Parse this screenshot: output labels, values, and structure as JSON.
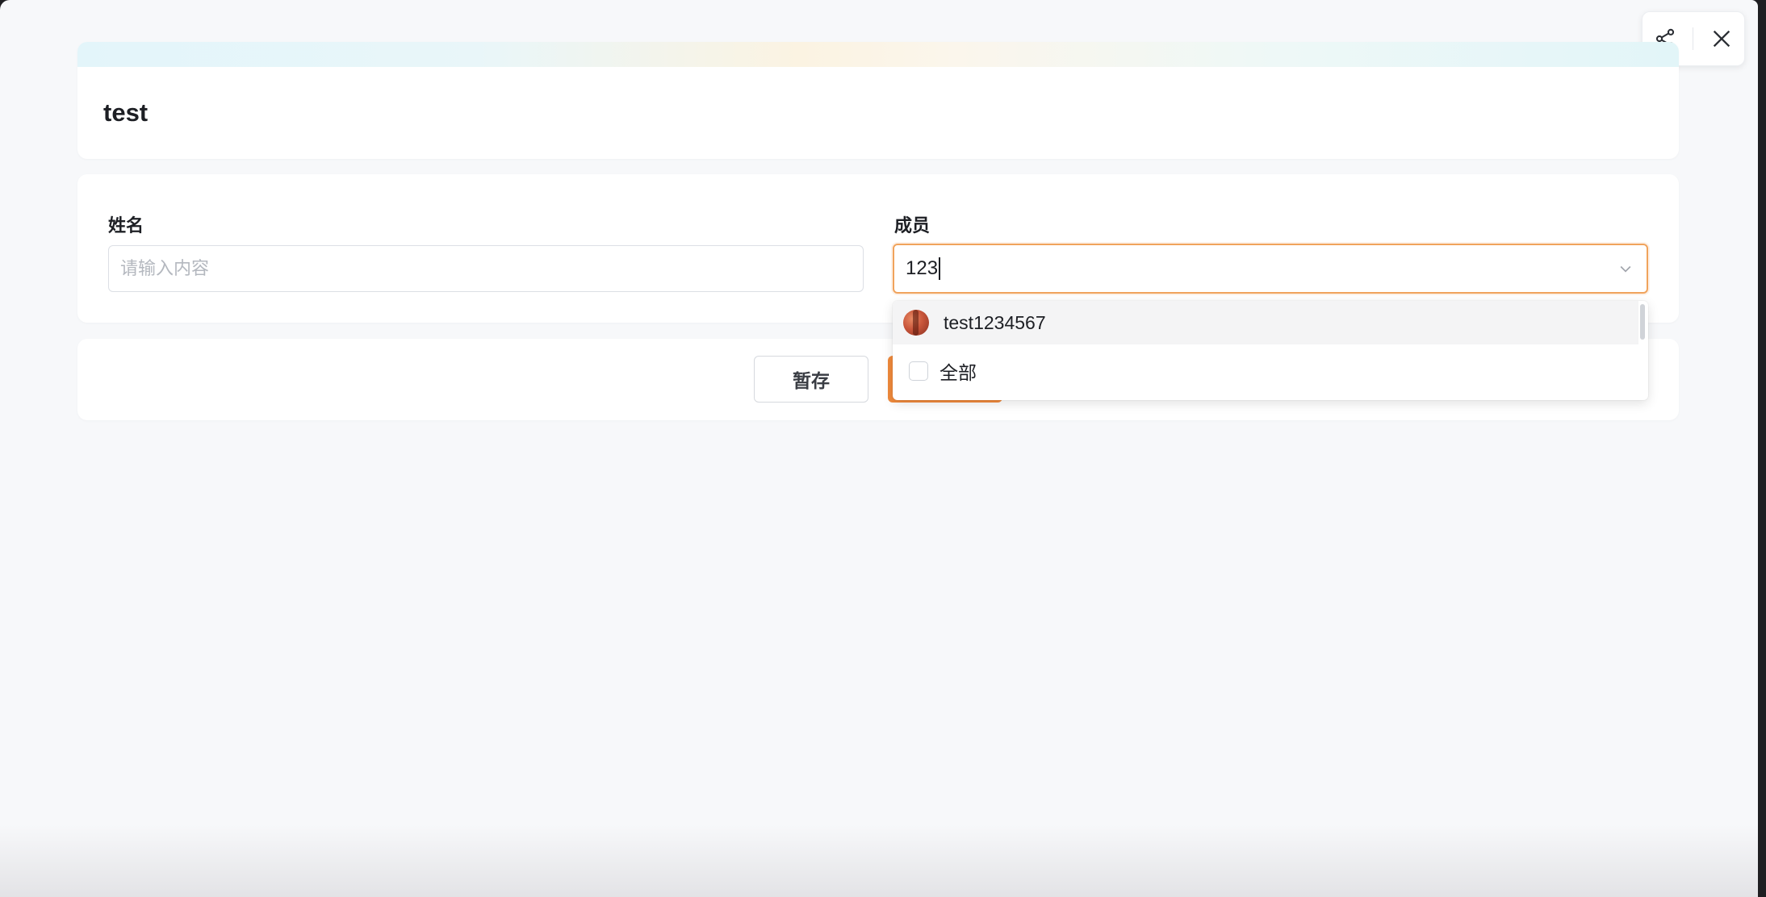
{
  "header": {
    "title": "test"
  },
  "toolbar": {
    "share_icon": "share-icon",
    "close_icon": "close-icon"
  },
  "form": {
    "name_field": {
      "label": "姓名",
      "placeholder": "请输入内容",
      "value": ""
    },
    "member_field": {
      "label": "成员",
      "value": "123"
    }
  },
  "footer": {
    "save_label": "暂存",
    "submit_label": ""
  },
  "dropdown": {
    "options": [
      {
        "label": "test1234567",
        "type": "user"
      },
      {
        "label": "全部",
        "type": "checkbox",
        "checked": false
      }
    ]
  },
  "colors": {
    "accent": "#f08a3c",
    "focus_border": "#f0a35c",
    "background": "#f7f8fa"
  }
}
